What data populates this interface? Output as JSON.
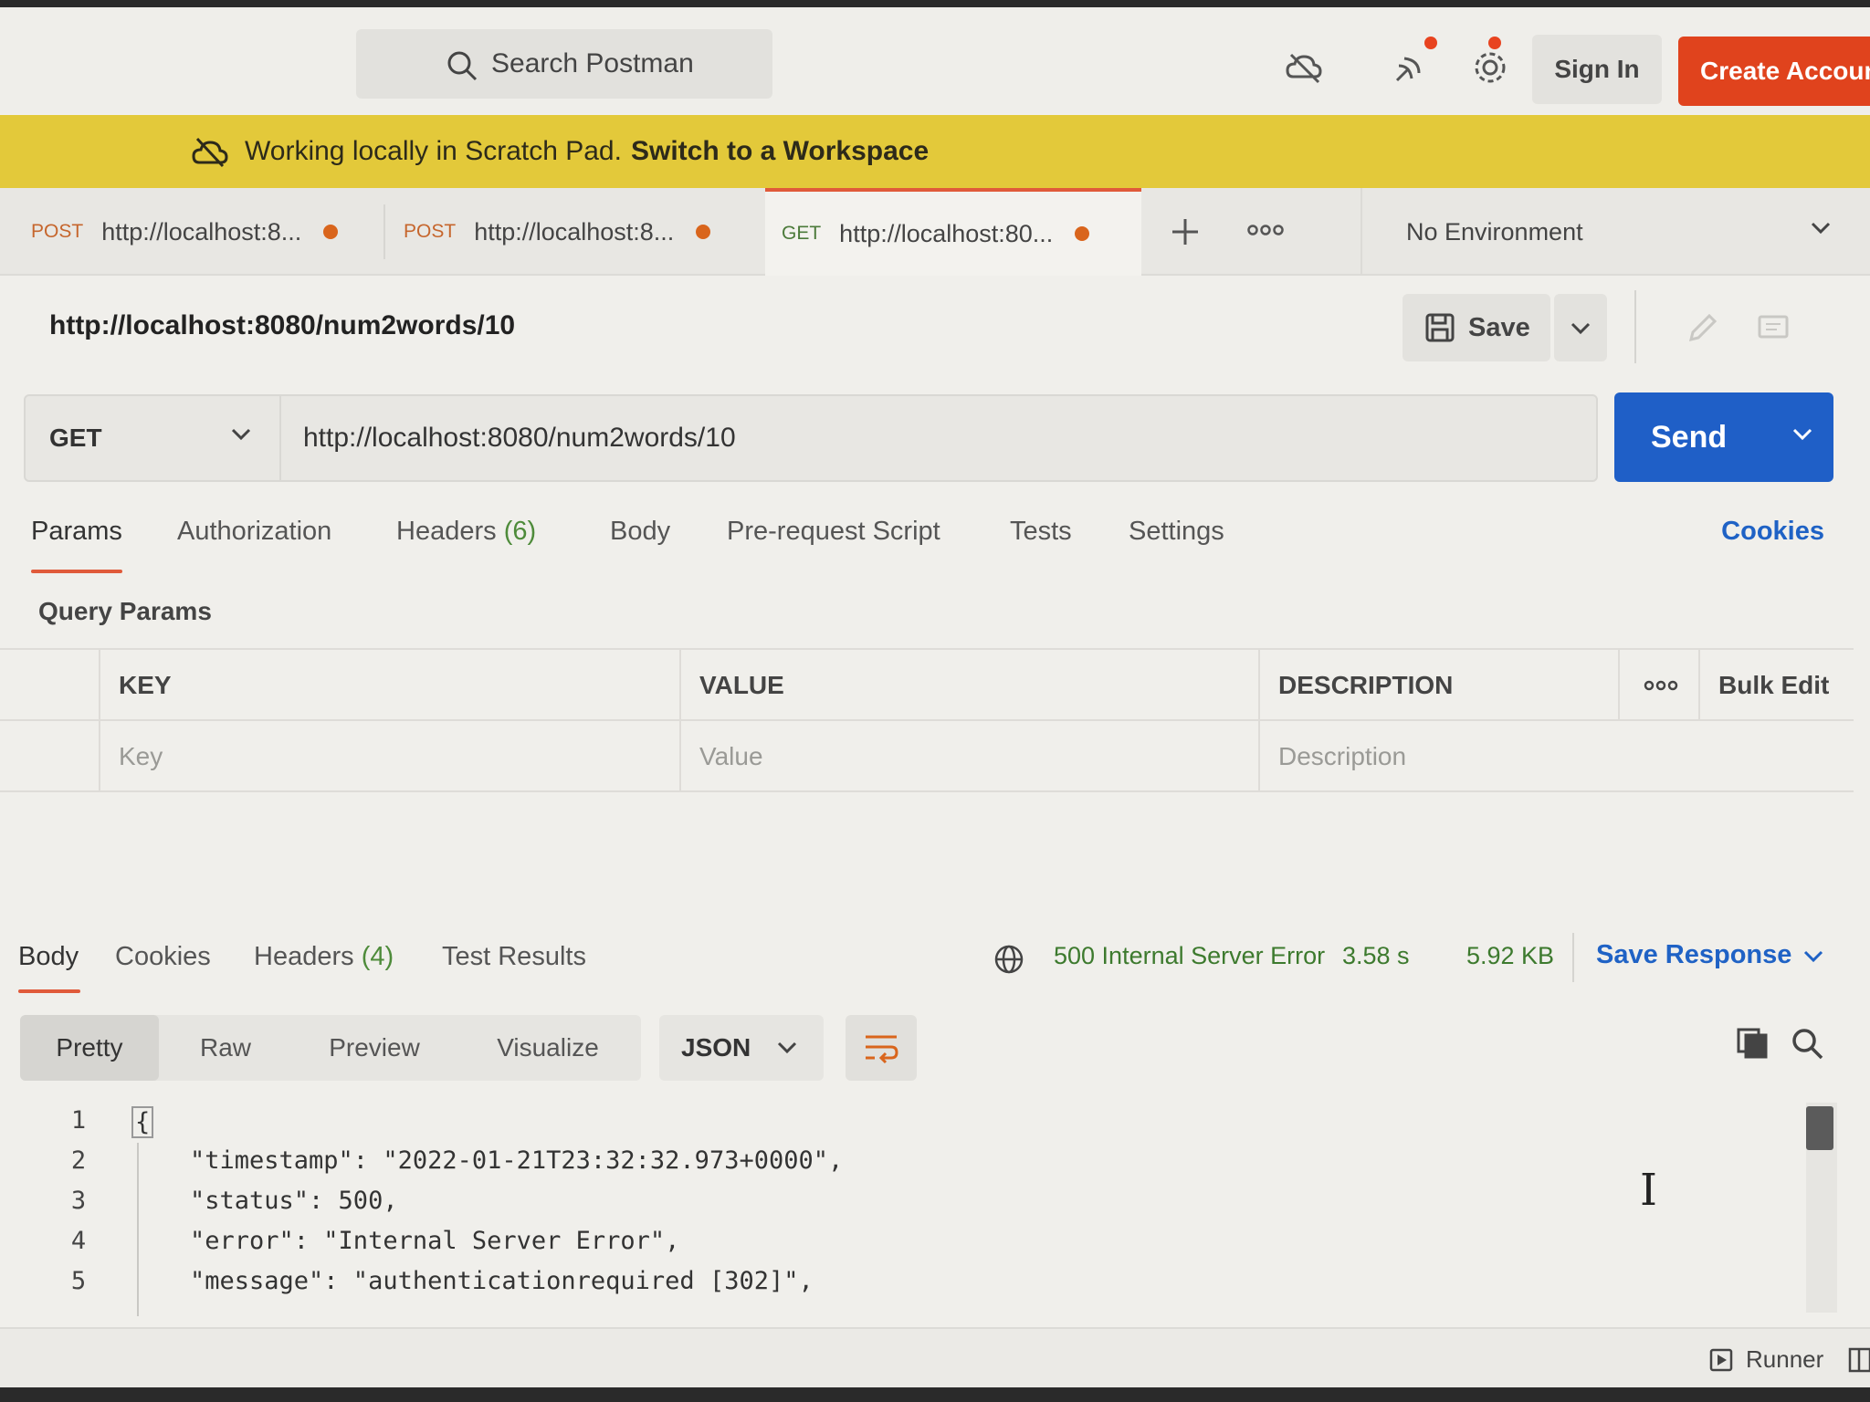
{
  "header": {
    "search_placeholder": "Search Postman",
    "sign_in": "Sign In",
    "create_account": "Create Account"
  },
  "banner": {
    "message": "Working locally in Scratch Pad.",
    "link": "Switch to a Workspace"
  },
  "tabs": [
    {
      "method": "POST",
      "url": "http://localhost:8..."
    },
    {
      "method": "POST",
      "url": "http://localhost:8..."
    },
    {
      "method": "GET",
      "url": "http://localhost:80..."
    }
  ],
  "environment": "No Environment",
  "request": {
    "title": "http://localhost:8080/num2words/10",
    "save_label": "Save",
    "method": "GET",
    "url": "http://localhost:8080/num2words/10",
    "send_label": "Send"
  },
  "request_tabs": {
    "params": "Params",
    "authorization": "Authorization",
    "headers": "Headers",
    "headers_count": "(6)",
    "body": "Body",
    "prerequest": "Pre-request Script",
    "tests": "Tests",
    "settings": "Settings",
    "cookies": "Cookies"
  },
  "query_params": {
    "label": "Query Params",
    "headers": {
      "key": "KEY",
      "value": "VALUE",
      "description": "DESCRIPTION",
      "bulk_edit": "Bulk Edit"
    },
    "placeholders": {
      "key": "Key",
      "value": "Value",
      "description": "Description"
    }
  },
  "response": {
    "tabs": {
      "body": "Body",
      "cookies": "Cookies",
      "headers": "Headers",
      "headers_count": "(4)",
      "test_results": "Test Results"
    },
    "status": "500 Internal Server Error",
    "time": "3.58 s",
    "size": "5.92 KB",
    "save_response": "Save Response",
    "views": {
      "pretty": "Pretty",
      "raw": "Raw",
      "preview": "Preview",
      "visualize": "Visualize"
    },
    "format": "JSON",
    "lines": [
      {
        "n": "1",
        "text": "{"
      },
      {
        "n": "2",
        "text": "\"timestamp\": \"2022-01-21T23:32:32.973+0000\","
      },
      {
        "n": "3",
        "text": "\"status\": 500,"
      },
      {
        "n": "4",
        "text": "\"error\": \"Internal Server Error\","
      },
      {
        "n": "5",
        "text": "\"message\": \"authenticationrequired [302]\","
      }
    ]
  },
  "footer": {
    "runner": "Runner"
  },
  "colors": {
    "accent": "#e05a3a",
    "send": "#1f5fc7",
    "banner": "#e3c93a",
    "create": "#e0431d",
    "status_ok_color": "#3d7a2e"
  }
}
